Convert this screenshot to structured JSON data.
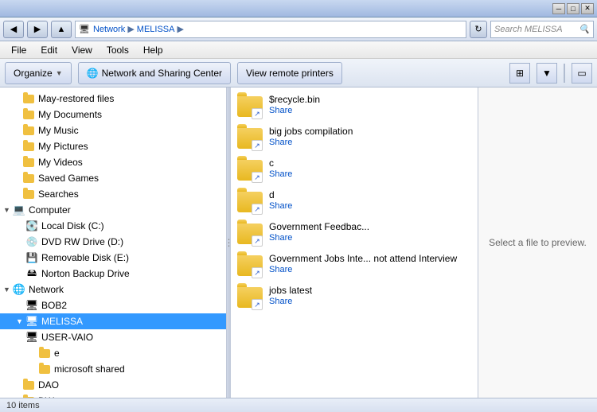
{
  "titlebar": {
    "minimize_label": "─",
    "maximize_label": "□",
    "close_label": "✕"
  },
  "addressbar": {
    "back_tooltip": "Back",
    "forward_tooltip": "Forward",
    "path_parts": [
      "Network",
      "MELISSA"
    ],
    "search_placeholder": "Search MELISSA",
    "refresh_label": "↻"
  },
  "menubar": {
    "items": [
      {
        "label": "File"
      },
      {
        "label": "Edit"
      },
      {
        "label": "View"
      },
      {
        "label": "Tools"
      },
      {
        "label": "Help"
      }
    ]
  },
  "toolbar": {
    "organize_label": "Organize",
    "network_sharing_label": "Network and Sharing Center",
    "view_remote_label": "View remote printers"
  },
  "sidebar": {
    "items": [
      {
        "id": "may-restored",
        "label": "May-restored files",
        "type": "folder",
        "indent": 1
      },
      {
        "id": "my-documents",
        "label": "My Documents",
        "type": "folder",
        "indent": 1
      },
      {
        "id": "my-music",
        "label": "My Music",
        "type": "folder",
        "indent": 1
      },
      {
        "id": "my-pictures",
        "label": "My Pictures",
        "type": "folder",
        "indent": 1
      },
      {
        "id": "my-videos",
        "label": "My Videos",
        "type": "folder",
        "indent": 1
      },
      {
        "id": "saved-games",
        "label": "Saved Games",
        "type": "folder",
        "indent": 1
      },
      {
        "id": "searches",
        "label": "Searches",
        "type": "folder",
        "indent": 1
      },
      {
        "id": "computer",
        "label": "Computer",
        "type": "computer",
        "indent": 0
      },
      {
        "id": "local-disk-c",
        "label": "Local Disk (C:)",
        "type": "disk",
        "indent": 1
      },
      {
        "id": "dvd-drive-d",
        "label": "DVD RW Drive (D:)",
        "type": "disk",
        "indent": 1
      },
      {
        "id": "removable-e",
        "label": "Removable Disk (E:)",
        "type": "disk",
        "indent": 1
      },
      {
        "id": "norton-backup",
        "label": "Norton Backup Drive",
        "type": "disk",
        "indent": 1
      },
      {
        "id": "network",
        "label": "Network",
        "type": "network",
        "indent": 0
      },
      {
        "id": "bob2",
        "label": "BOB2",
        "type": "computer-node",
        "indent": 1
      },
      {
        "id": "melissa",
        "label": "MELISSA",
        "type": "computer-node",
        "indent": 1,
        "selected": true
      },
      {
        "id": "user-vaio",
        "label": "USER-VAIO",
        "type": "computer-node",
        "indent": 1
      },
      {
        "id": "e-share",
        "label": "e",
        "type": "folder-share",
        "indent": 2
      },
      {
        "id": "microsoft-shared",
        "label": "microsoft shared",
        "type": "folder-share",
        "indent": 2
      },
      {
        "id": "dao",
        "label": "DAO",
        "type": "folder",
        "indent": 1
      },
      {
        "id": "dw",
        "label": "DW",
        "type": "folder",
        "indent": 1
      }
    ]
  },
  "files": {
    "items": [
      {
        "name": "$recycle.bin",
        "share_label": "Share"
      },
      {
        "name": "big jobs compilation",
        "share_label": "Share"
      },
      {
        "name": "c",
        "share_label": "Share"
      },
      {
        "name": "d",
        "share_label": "Share"
      },
      {
        "name": "Government Feedbac...",
        "share_label": "Share"
      },
      {
        "name": "Government Jobs Inte... not attend Interview",
        "share_label": "Share"
      },
      {
        "name": "jobs latest",
        "share_label": "Share"
      }
    ]
  },
  "preview": {
    "text": "Select a file to preview."
  },
  "statusbar": {
    "text": "10 items"
  }
}
